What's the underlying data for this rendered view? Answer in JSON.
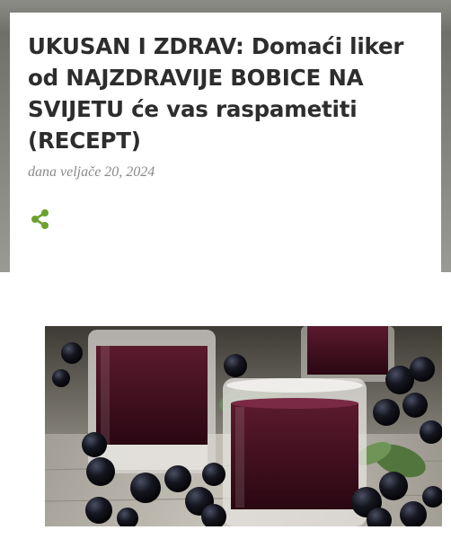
{
  "article": {
    "title": "UKUSAN I ZDRAV: Domaći liker od NAJZDRAVIJE BOBICE NA SVIJETU će vas raspametiti (RECEPT)",
    "date": "dana veljače 20, 2024"
  },
  "icons": {
    "share": "share-icon"
  },
  "colors": {
    "accent": "#6aa12f",
    "title": "#2d2d2d",
    "date": "#8a8a8a"
  },
  "image": {
    "subject": "chokeberry-liqueur-glasses-photo"
  }
}
